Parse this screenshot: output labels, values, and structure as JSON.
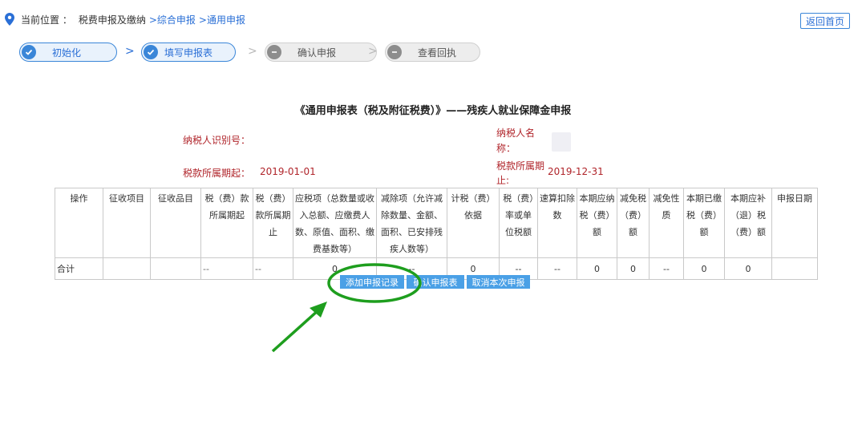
{
  "location_bar": {
    "label": "当前位置 ：",
    "crumbs": [
      "税费申报及缴纳",
      ">综合申报",
      ">通用申报"
    ]
  },
  "home_button": "返回首页",
  "steps": [
    {
      "label": "初始化",
      "state": "done"
    },
    {
      "label": "填写申报表",
      "state": "done"
    },
    {
      "label": "确认申报",
      "state": "todo"
    },
    {
      "label": "查看回执",
      "state": "todo"
    }
  ],
  "form": {
    "title": "《通用申报表（税及附征税费）》——残疾人就业保障金申报",
    "taxpayer_id_label": "纳税人识别号：",
    "taxpayer_id_value": "",
    "taxpayer_name_label_line1": "纳税人名",
    "taxpayer_name_label_line2": "称：",
    "period_start_label": "税款所属期起：",
    "period_start_value": "2019-01-01",
    "period_end_label_line1": "税款所属期",
    "period_end_label_line2": "止:",
    "period_end_value": "2019-12-31"
  },
  "table": {
    "headers": [
      "操作",
      "征收项目",
      "征收品目",
      "税（费）款所属期起",
      "税（费）款所属期止",
      "应税项（总数量或收入总额、应缴费人数、原值、面积、缴费基数等）",
      "减除项（允许减除数量、金额、面积、已安排残疾人数等）",
      "计税（费）依据",
      "税（费）率或单位税额",
      "速算扣除数",
      "本期应纳税（费）额",
      "减免税（费）额",
      "减免性质",
      "本期已缴税（费）额",
      "本期应补（退）税（费）额",
      "申报日期"
    ],
    "total_row": [
      "合计",
      "",
      "",
      "--",
      "--",
      "0",
      "--",
      "0",
      "--",
      "--",
      "0",
      "0",
      "--",
      "0",
      "0",
      ""
    ]
  },
  "buttons": {
    "add": "添加申报记录",
    "confirm": "确认申报表",
    "cancel": "取消本次申报"
  },
  "colors": {
    "accent": "#3a86d8",
    "label_red": "#b0242a",
    "button_blue": "#4aa0e6",
    "annotation_green": "#1e9e1e"
  }
}
